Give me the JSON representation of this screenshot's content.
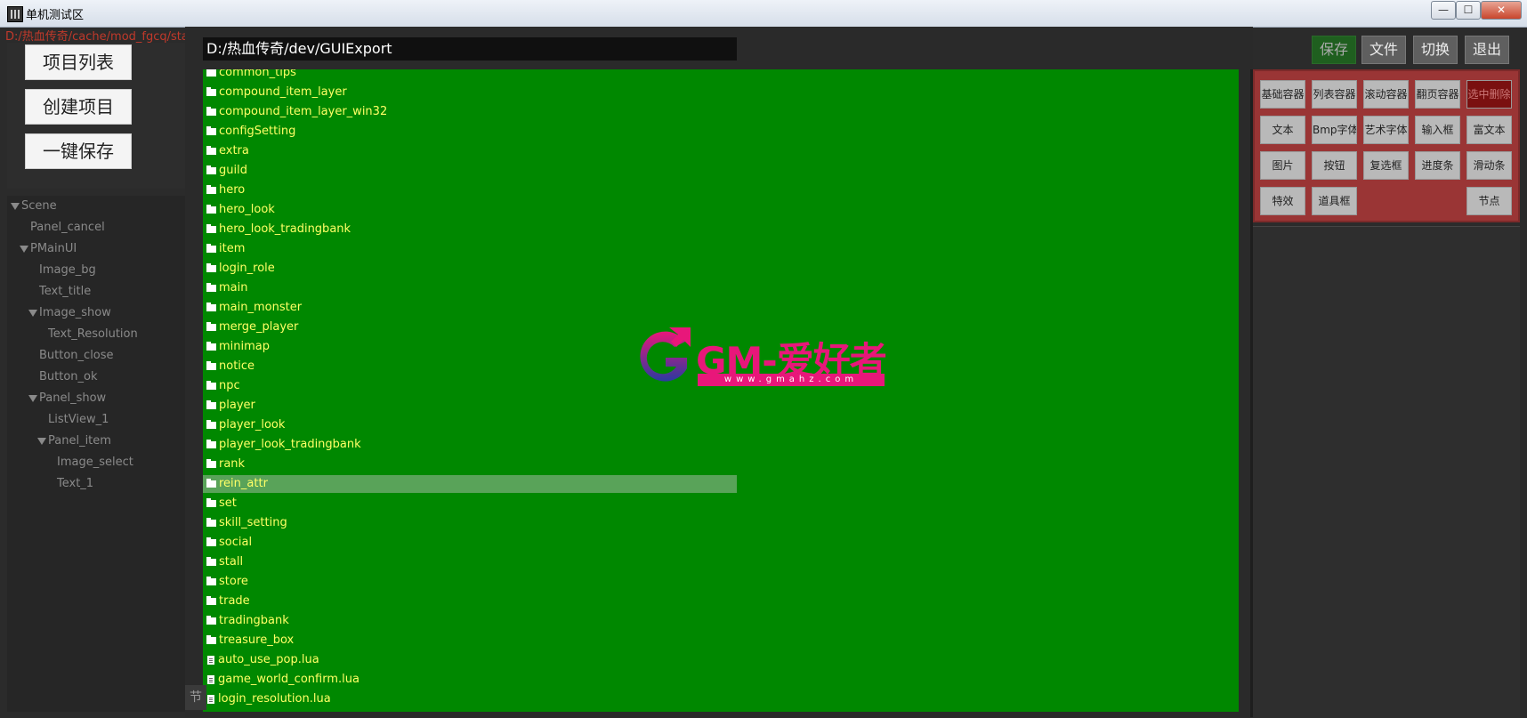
{
  "window": {
    "title": "单机测试区",
    "controls": [
      "—",
      "☐",
      "✕"
    ]
  },
  "background_path": "D:/热血传奇/cache/mod_fgcq/stab/GUIExport/set/set_win_size_pop.lua",
  "left_buttons": [
    "项目列表",
    "创建项目",
    "一键保存"
  ],
  "tree": [
    {
      "label": "Scene",
      "level": 0,
      "expanded": true
    },
    {
      "label": "Panel_cancel",
      "level": 1,
      "expanded": false
    },
    {
      "label": "PMainUI",
      "level": 1,
      "expanded": true
    },
    {
      "label": "Image_bg",
      "level": 2,
      "expanded": false
    },
    {
      "label": "Text_title",
      "level": 2,
      "expanded": false
    },
    {
      "label": "Image_show",
      "level": 2,
      "expanded": true
    },
    {
      "label": "Text_Resolution",
      "level": 3,
      "expanded": false
    },
    {
      "label": "Button_close",
      "level": 2,
      "expanded": false
    },
    {
      "label": "Button_ok",
      "level": 2,
      "expanded": false
    },
    {
      "label": "Panel_show",
      "level": 2,
      "expanded": true
    },
    {
      "label": "ListView_1",
      "level": 3,
      "expanded": false
    },
    {
      "label": "Panel_item",
      "level": 3,
      "expanded": true
    },
    {
      "label": "Image_select",
      "level": 4,
      "expanded": false
    },
    {
      "label": "Text_1",
      "level": 4,
      "expanded": false
    }
  ],
  "file_browser": {
    "path": "D:/热血传奇/dev/GUIExport",
    "selected": "rein_attr",
    "items": [
      {
        "name": "common_tips",
        "type": "folder"
      },
      {
        "name": "compound_item_layer",
        "type": "folder"
      },
      {
        "name": "compound_item_layer_win32",
        "type": "folder"
      },
      {
        "name": "configSetting",
        "type": "folder"
      },
      {
        "name": "extra",
        "type": "folder"
      },
      {
        "name": "guild",
        "type": "folder"
      },
      {
        "name": "hero",
        "type": "folder"
      },
      {
        "name": "hero_look",
        "type": "folder"
      },
      {
        "name": "hero_look_tradingbank",
        "type": "folder"
      },
      {
        "name": "item",
        "type": "folder"
      },
      {
        "name": "login_role",
        "type": "folder"
      },
      {
        "name": "main",
        "type": "folder"
      },
      {
        "name": "main_monster",
        "type": "folder"
      },
      {
        "name": "merge_player",
        "type": "folder"
      },
      {
        "name": "minimap",
        "type": "folder"
      },
      {
        "name": "notice",
        "type": "folder"
      },
      {
        "name": "npc",
        "type": "folder"
      },
      {
        "name": "player",
        "type": "folder"
      },
      {
        "name": "player_look",
        "type": "folder"
      },
      {
        "name": "player_look_tradingbank",
        "type": "folder"
      },
      {
        "name": "rank",
        "type": "folder"
      },
      {
        "name": "rein_attr",
        "type": "folder"
      },
      {
        "name": "set",
        "type": "folder"
      },
      {
        "name": "skill_setting",
        "type": "folder"
      },
      {
        "name": "social",
        "type": "folder"
      },
      {
        "name": "stall",
        "type": "folder"
      },
      {
        "name": "store",
        "type": "folder"
      },
      {
        "name": "trade",
        "type": "folder"
      },
      {
        "name": "tradingbank",
        "type": "folder"
      },
      {
        "name": "treasure_box",
        "type": "folder"
      },
      {
        "name": "auto_use_pop.lua",
        "type": "file"
      },
      {
        "name": "game_world_confirm.lua",
        "type": "file"
      },
      {
        "name": "login_resolution.lua",
        "type": "file"
      }
    ]
  },
  "watermark": {
    "text": "GM-爱好者",
    "url": "www.gmahz.com"
  },
  "top_right_buttons": [
    "保存",
    "文件",
    "切换",
    "退出"
  ],
  "widget_palette": {
    "rows": [
      [
        "基础容器",
        "列表容器",
        "滚动容器",
        "翻页容器",
        "选中删除"
      ],
      [
        "文本",
        "Bmp字体",
        "艺术字体",
        "输入框",
        "富文本"
      ],
      [
        "图片",
        "按钮",
        "复选框",
        "进度条",
        "滑动条"
      ],
      [
        "特效",
        "道具框",
        "",
        "",
        "节点"
      ]
    ]
  },
  "bottom_tab": "节",
  "colors": {
    "file_panel_bg": "#008800",
    "file_text": "#ffff66",
    "selected_row": "#59a359",
    "palette_bg": "#9a3535",
    "watermark": "#e8177a"
  }
}
